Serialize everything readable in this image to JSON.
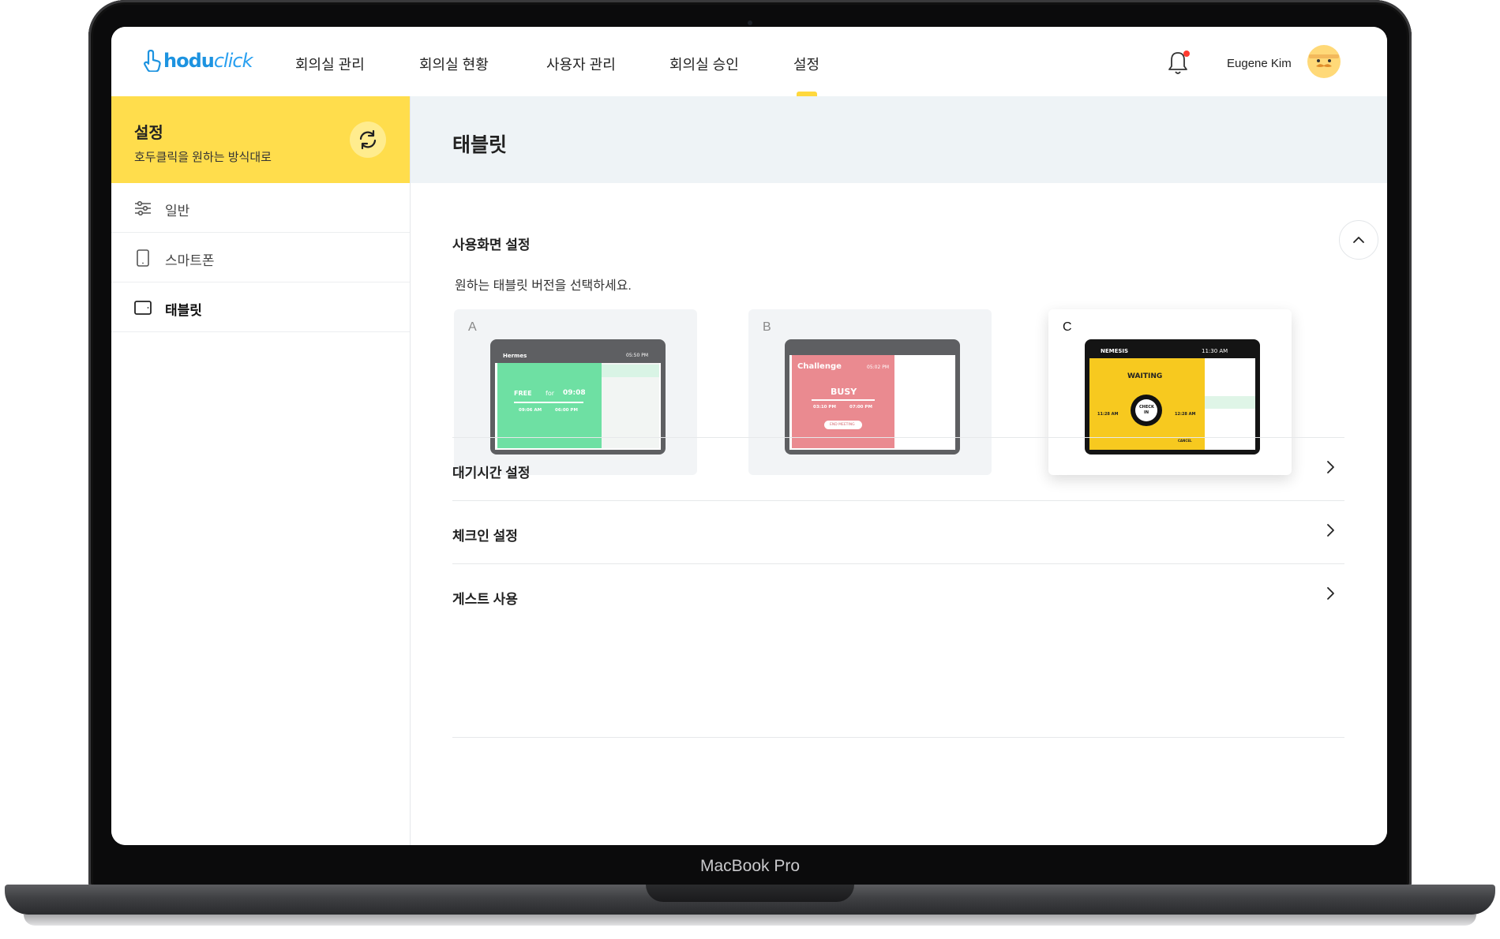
{
  "device": {
    "brand": "MacBook Pro"
  },
  "header": {
    "logo": {
      "main": "hodu",
      "accent": "click"
    },
    "nav": [
      {
        "label": "회의실 관리"
      },
      {
        "label": "회의실 현황"
      },
      {
        "label": "사용자 관리"
      },
      {
        "label": "회의실 승인"
      },
      {
        "label": "설정",
        "active": true
      }
    ],
    "user_name": "Eugene Kim",
    "notification_icon": "bell-icon",
    "has_notification": true
  },
  "sidebar": {
    "title": "설정",
    "subtitle": "호두클릭을 원하는 방식대로",
    "refresh_icon": "refresh-icon",
    "items": [
      {
        "label": "일반",
        "icon": "sliders-icon",
        "active": false
      },
      {
        "label": "스마트폰",
        "icon": "smartphone-icon",
        "active": false
      },
      {
        "label": "태블릿",
        "icon": "tablet-icon",
        "active": true
      }
    ]
  },
  "main": {
    "title": "태블릿",
    "section": {
      "title": "사용화면 설정",
      "description": "원하는 태블릿 버전을 선택하세요.",
      "expanded": true
    },
    "tablet_options": [
      {
        "letter": "A",
        "selected": false,
        "preview": {
          "room": "Hermes",
          "status": "FREE",
          "for": "for",
          "duration": "09:08",
          "start": "09:06 AM",
          "end": "06:00 PM",
          "clock": "05:50 PM",
          "color": "#6ee0a3"
        }
      },
      {
        "letter": "B",
        "selected": false,
        "preview": {
          "room": "Challenge",
          "status": "BUSY",
          "clock": "05:02 PM",
          "start": "03:10 PM",
          "end": "07:00 PM",
          "button": "END MEETING",
          "color": "#ea8a90"
        }
      },
      {
        "letter": "C",
        "selected": true,
        "preview": {
          "room": "NEMESIS",
          "clock": "11:30 AM",
          "status": "WAITING",
          "check_in": [
            "CHECK",
            "IN"
          ],
          "left_time": "11:28 AM",
          "right_time": "12:28 AM",
          "cancel": "CANCEL",
          "color": "#f7c91f"
        }
      }
    ],
    "settings_rows": [
      {
        "label": "대기시간 설정"
      },
      {
        "label": "체크인 설정"
      },
      {
        "label": "게스트 사용"
      }
    ]
  },
  "colors": {
    "accent_yellow": "#ffdd4c",
    "brand_blue": "#1d93e0",
    "notification_red": "#ff3b30"
  }
}
